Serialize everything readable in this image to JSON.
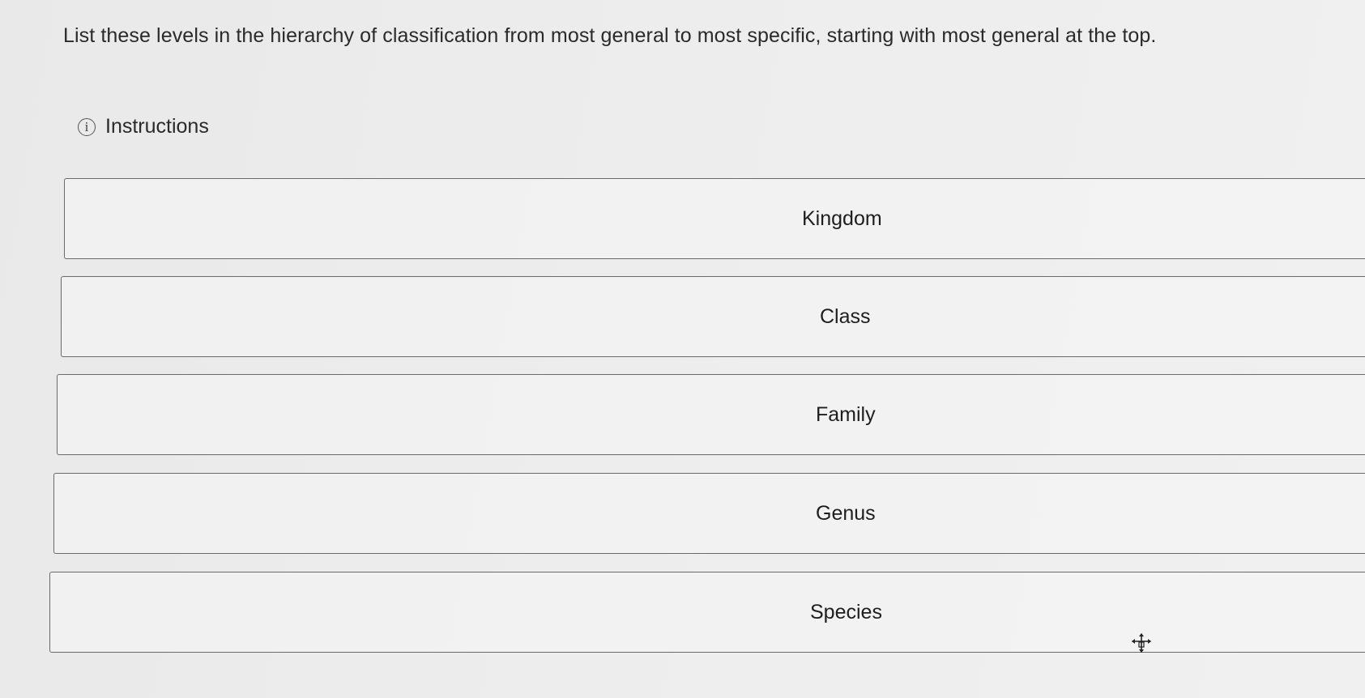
{
  "question": {
    "text": "List these levels in the hierarchy of classification from most general to most specific, starting with most general at the top."
  },
  "instructions": {
    "icon": "info-icon",
    "label": "Instructions"
  },
  "ordering_items": [
    {
      "label": "Kingdom"
    },
    {
      "label": "Class"
    },
    {
      "label": "Family"
    },
    {
      "label": "Genus"
    },
    {
      "label": "Species"
    }
  ],
  "cursor": {
    "icon": "move-cursor-icon"
  }
}
